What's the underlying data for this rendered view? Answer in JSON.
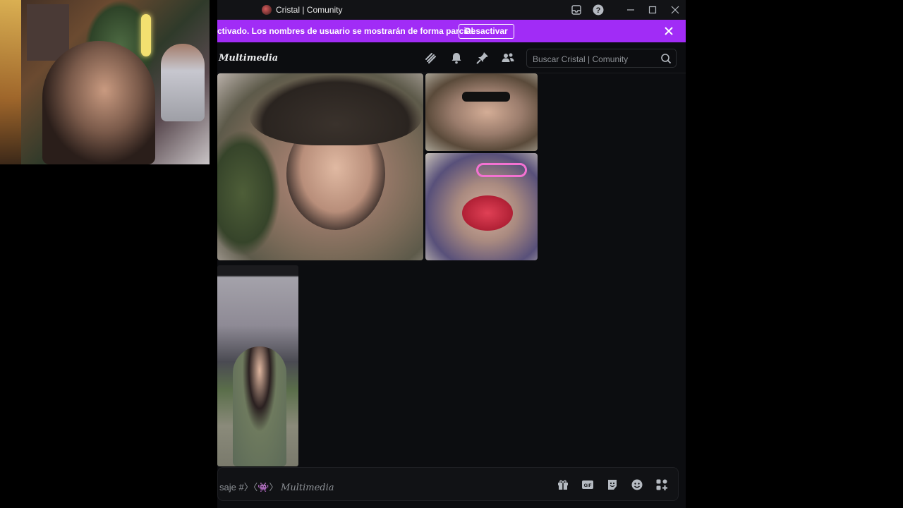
{
  "window": {
    "title": "Cristal | Comunity"
  },
  "banner": {
    "text": "ctivado. Los nombres de usuario se mostrarán de forma parcial.",
    "button_label": "Desactivar"
  },
  "header": {
    "channel_name": "Multimedia",
    "search_placeholder": "Buscar Cristal | Comunity",
    "icons": [
      "threads-icon",
      "bell-icon",
      "pin-icon",
      "members-icon",
      "search-icon"
    ]
  },
  "media": [
    "cowboy-hat-video",
    "sunglasses-video",
    "big-lips-video",
    "phone-screenshot-video"
  ],
  "composer": {
    "placeholder_prefix": "saje #〉〈👾〉",
    "placeholder_channel": "Multimedia",
    "icons": [
      "gift-icon",
      "gif-icon",
      "sticker-icon",
      "emoji-icon",
      "apps-icon"
    ]
  },
  "colors": {
    "banner": "#a12cf6",
    "background": "#0c0d10"
  }
}
